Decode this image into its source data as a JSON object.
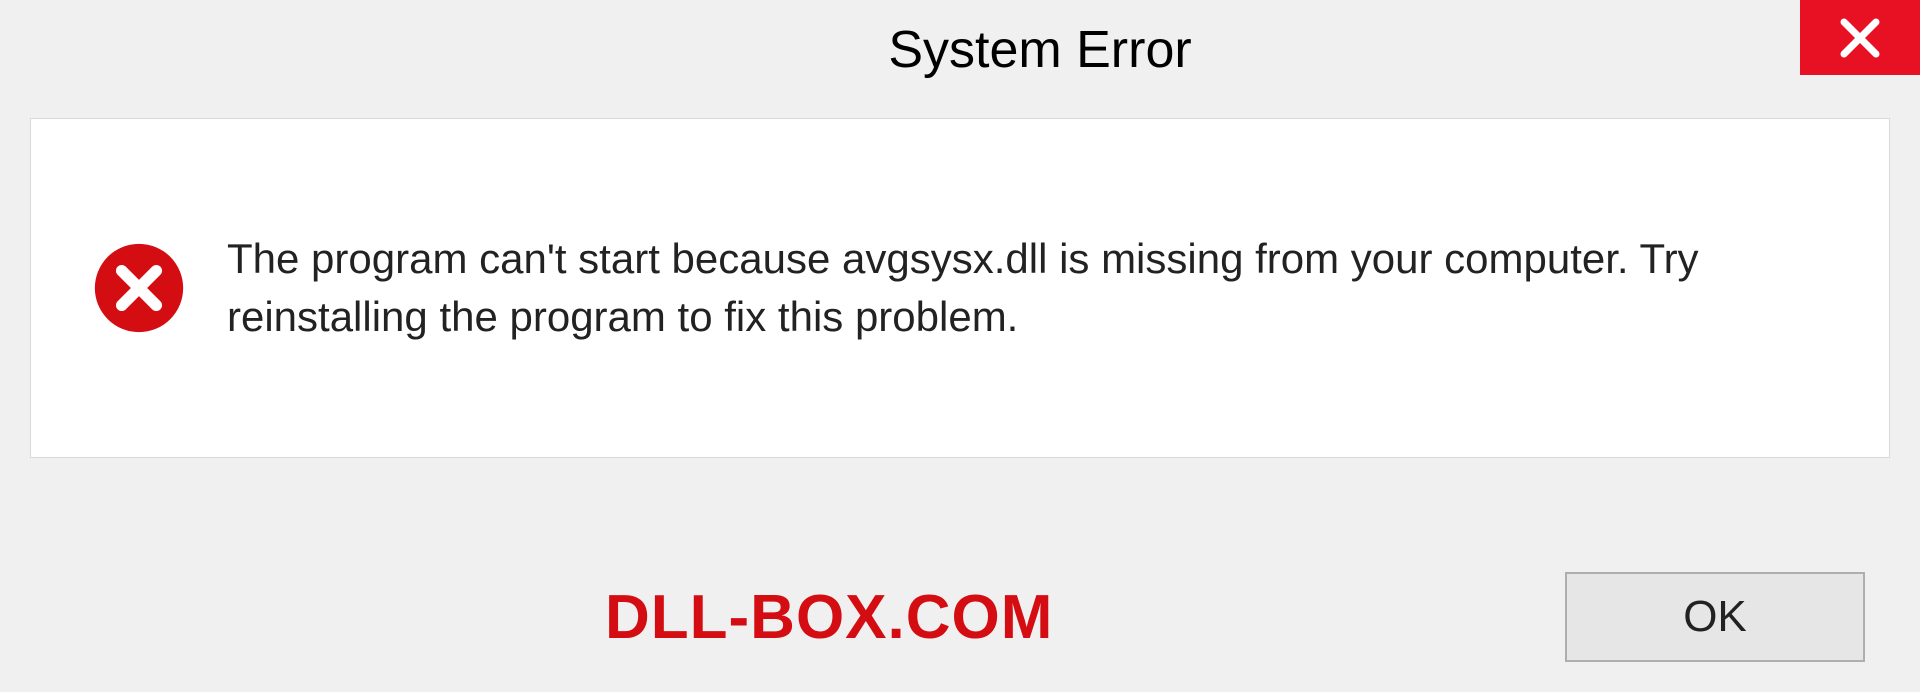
{
  "dialog": {
    "title": "System Error",
    "message": "The program can't start because avgsysx.dll is missing from your computer. Try reinstalling the program to fix this problem.",
    "ok_label": "OK"
  },
  "watermark": "DLL-BOX.COM",
  "colors": {
    "close_bg": "#e81123",
    "error_icon": "#d40d12",
    "watermark": "#d40d12"
  }
}
